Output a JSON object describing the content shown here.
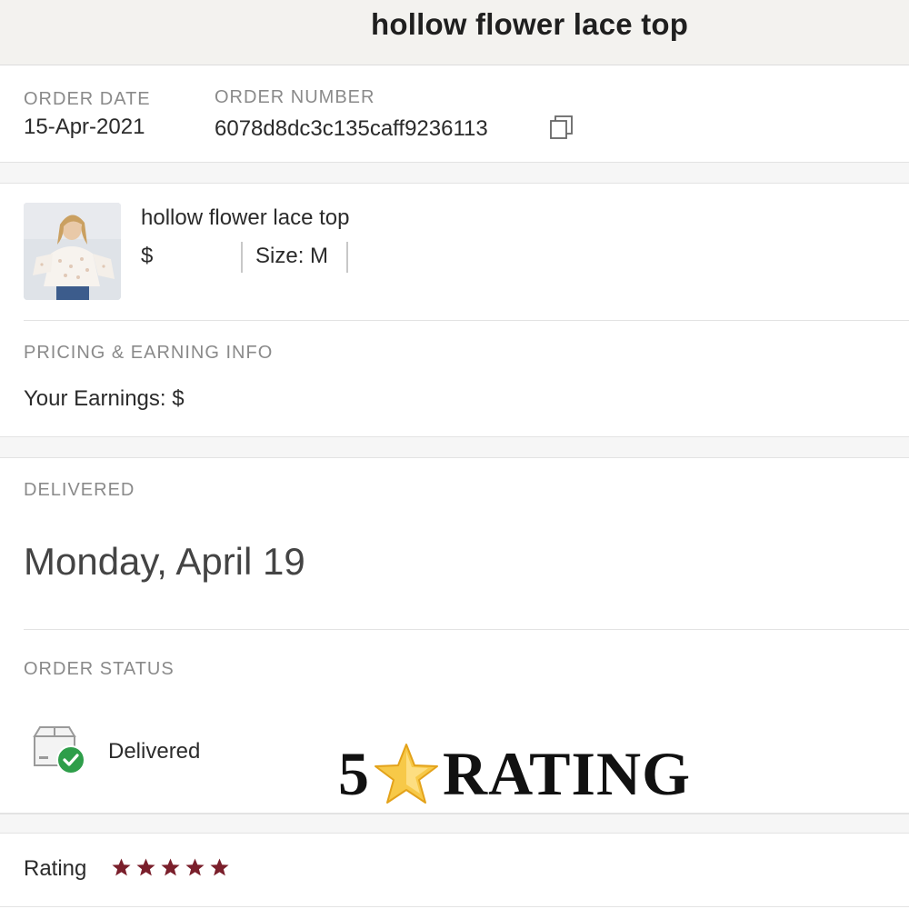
{
  "header": {
    "title": "hollow flower lace top"
  },
  "order": {
    "date_label": "ORDER DATE",
    "date_value": "15-Apr-2021",
    "number_label": "ORDER NUMBER",
    "number_value": "6078d8dc3c135caff9236113"
  },
  "item": {
    "name": "hollow flower lace top",
    "price_prefix": "$",
    "size": "Size: M"
  },
  "pricing": {
    "label": "PRICING & EARNING INFO",
    "earnings": "Your Earnings: $"
  },
  "delivery": {
    "label": "DELIVERED",
    "date": "Monday, April 19"
  },
  "status": {
    "label": "ORDER STATUS",
    "value": "Delivered"
  },
  "overlay": {
    "left": "5",
    "right": "RATING"
  },
  "rating": {
    "label": "Rating",
    "stars": 5,
    "max": 5,
    "star_color": "#7a1f2b"
  },
  "colors": {
    "check_green": "#2e9e4a",
    "star_gold": "#f7c948"
  },
  "icons": {
    "copy": "copy-icon",
    "package": "package-delivered-icon",
    "star": "star-icon"
  }
}
